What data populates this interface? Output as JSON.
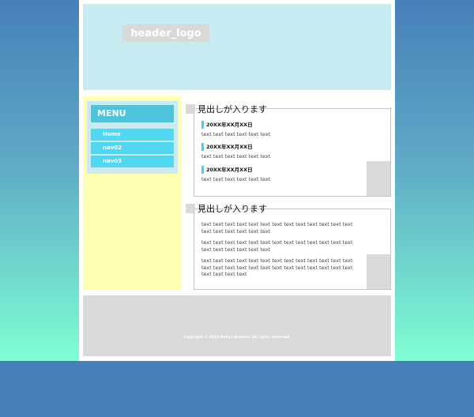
{
  "colors": {
    "background": "#4580b7",
    "gradient_top": "#4680b8",
    "gradient_bottom": "#7ffed2",
    "header_bg": "#c8eaf1",
    "sidebar_bg": "#ffffb4",
    "menu_title_bg": "#4dc3dc",
    "menu_item_bg": "#51d7f0",
    "footer_bg": "#d9d9d9"
  },
  "header": {
    "logo": "header_logo"
  },
  "sidebar": {
    "menu_title": "MENU",
    "items": [
      {
        "label": "Home"
      },
      {
        "label": "nav02"
      },
      {
        "label": "nav03"
      }
    ]
  },
  "main": {
    "sections": [
      {
        "heading": "見出しが入ります",
        "news": [
          {
            "date": "20XX年XX月XX日",
            "text": "text text text text text text"
          },
          {
            "date": "20XX年XX月XX日",
            "text": "text text text text text text"
          },
          {
            "date": "20XX年XX月XX日",
            "text": "text text text text text text"
          }
        ]
      },
      {
        "heading": "見出しが入ります",
        "paragraphs": [
          "text text text text text text text text text text text text text text text text text text text",
          "text text text text text text text text text text text text text text text text text text text",
          "text text text text text text text text text text text text text text text text text text text text text text text text text text text text text text"
        ]
      }
    ]
  },
  "footer": {
    "copyright": "Copyright © 2023 Nahyo Aramaki All rights reserved."
  }
}
